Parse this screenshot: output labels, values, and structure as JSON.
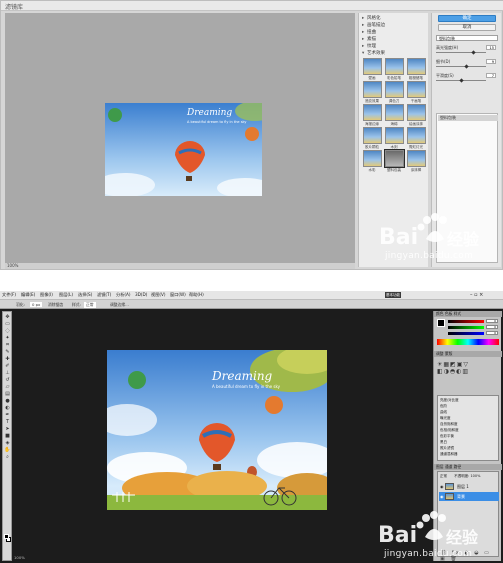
{
  "top": {
    "app_title": "滤镜库",
    "status": "100%",
    "folders": [
      "风格化",
      "画笔描边",
      "扭曲",
      "素描",
      "纹理",
      "艺术效果"
    ],
    "thumbnails": [
      "壁画",
      "彩色铅笔",
      "粗糙蜡笔",
      "底纹效果",
      "调色刀",
      "干画笔",
      "海报边缘",
      "海绵",
      "绘画涂抹",
      "胶片颗粒",
      "木刻",
      "霓虹灯光",
      "水彩",
      "塑料包装",
      "涂抹棒"
    ],
    "selected_thumbnail": "塑料包装",
    "ok_label": "确定",
    "cancel_label": "取消",
    "filter_select": "塑料包装",
    "params": [
      {
        "label": "高光强度(H)",
        "value": "15",
        "level": 0.75
      },
      {
        "label": "细节(D)",
        "value": "9",
        "level": 0.6
      },
      {
        "label": "平滑度(S)",
        "value": "7",
        "level": 0.5
      }
    ],
    "layer_item": "塑料包装"
  },
  "bottom": {
    "menu": [
      "文件(F)",
      "编辑(E)",
      "图像(I)",
      "图层(L)",
      "选择(S)",
      "滤镜(T)",
      "分析(A)",
      "3D(D)",
      "视图(V)",
      "窗口(W)",
      "帮助(H)"
    ],
    "options": [
      "羽化:",
      "0 px",
      "消除锯齿",
      "样式:",
      "正常",
      "调整边缘..."
    ],
    "workspace": "基本功能",
    "status": "100%",
    "panel_tabs": [
      "颜色",
      "色板",
      "样式",
      "调整",
      "蒙版",
      "图层",
      "通道",
      "路径"
    ],
    "color_values": [
      "0",
      "0",
      "0"
    ],
    "presets": [
      "亮度/对比度",
      "色阶",
      "曲线",
      "曝光度",
      "自然饱和度",
      "色相/饱和度",
      "色彩平衡",
      "黑白",
      "照片滤镜",
      "通道混和器"
    ],
    "blend_mode": "正常",
    "opacity_label": "不透明度:",
    "opacity_value": "100%",
    "layers": [
      {
        "name": "图层 1",
        "active": false
      },
      {
        "name": "背景",
        "active": true
      }
    ]
  },
  "image": {
    "brand_text": "Dreaming",
    "brand_subtext": "A beautiful dream to fly in the sky"
  },
  "watermark": {
    "brand_main": "Bai",
    "brand_cn": "经验",
    "url": "jingyan.baidu.com"
  },
  "colors": {
    "ok_button": "#4c9fe6",
    "active_layer": "#3b8ee6",
    "dark_canvas": "#1c1c1c",
    "gallery_bg": "#a9a9a9"
  }
}
